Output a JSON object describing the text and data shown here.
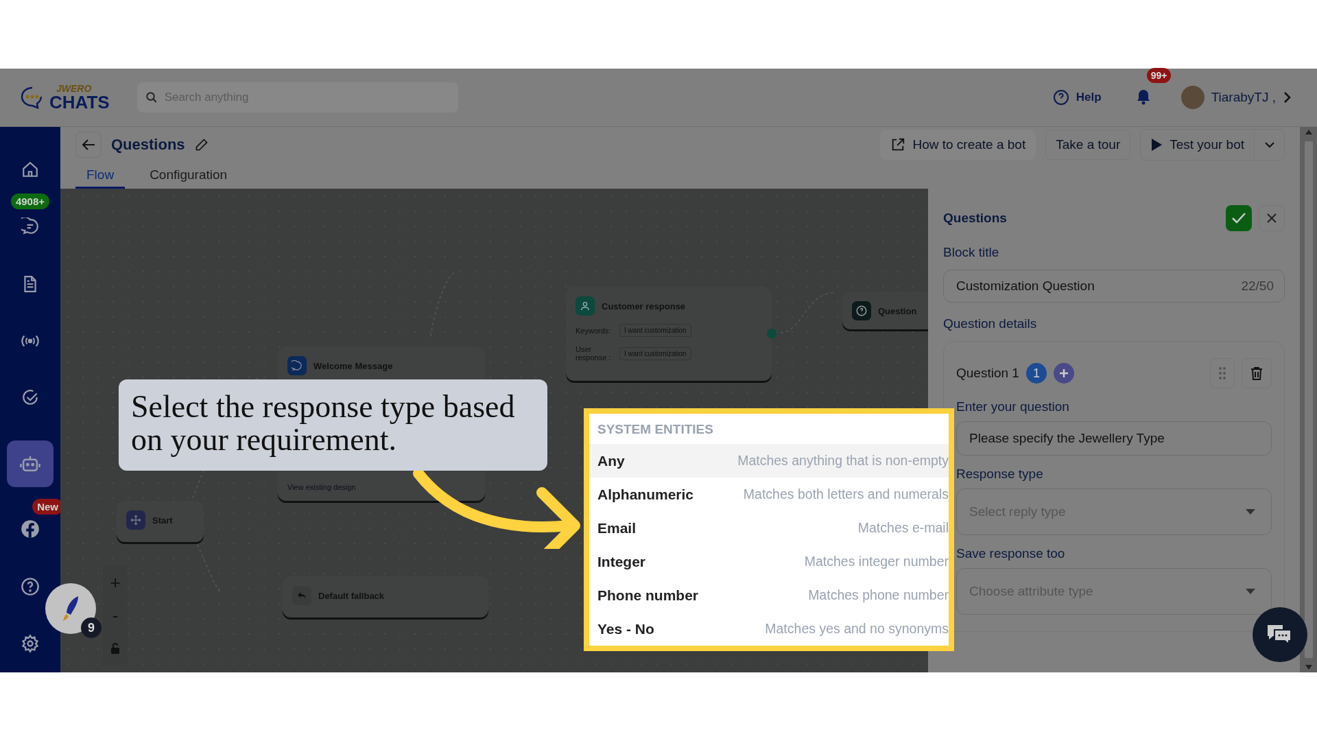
{
  "header": {
    "logo_top": "JWERO",
    "logo_bottom": "CHATS",
    "search": {
      "placeholder": "Search anything"
    },
    "help": "Help",
    "notifications": "99+",
    "user": "TiarabyTJ ,"
  },
  "sidebar": {
    "items": [
      {
        "kind": "home",
        "selected": false
      },
      {
        "kind": "chat",
        "selected": false,
        "badge": {
          "text": "4908+",
          "color": "#0d6b12"
        }
      },
      {
        "kind": "document",
        "selected": false
      },
      {
        "kind": "broadcast",
        "selected": false
      },
      {
        "kind": "check",
        "selected": false
      },
      {
        "kind": "bot",
        "selected": true
      },
      {
        "kind": "facebook",
        "selected": false,
        "badge": {
          "text": "New",
          "color": "#8e1313"
        }
      },
      {
        "kind": "help",
        "selected": false
      },
      {
        "kind": "settings",
        "selected": false
      }
    ]
  },
  "launcher": {
    "count": "9"
  },
  "page": {
    "title": "Questions",
    "actions": [
      {
        "label": "How to create a bot",
        "kind": "link"
      },
      {
        "label": "Take a tour",
        "kind": "plain"
      },
      {
        "label": "Test your bot",
        "kind": "play"
      }
    ],
    "tabs": [
      {
        "label": "Flow",
        "selected": true
      },
      {
        "label": "Configuration",
        "selected": false
      }
    ]
  },
  "canvas": {
    "nodes": [
      {
        "kind": "customer_response",
        "title": "Customer response",
        "fields": [
          {
            "label": "Keywords:",
            "value": "I want customization"
          },
          {
            "label": "User response :",
            "value": "I want customization"
          }
        ]
      },
      {
        "kind": "question",
        "title": "Question"
      },
      {
        "kind": "message",
        "title": "Welcome Message",
        "link": "View existing design"
      },
      {
        "kind": "start",
        "title": "Start"
      },
      {
        "kind": "fallback",
        "title": "Default fallback"
      }
    ],
    "zoom_controls": [
      "+",
      "-"
    ]
  },
  "tutorial": {
    "callout": "Select the response type based on your requirement."
  },
  "entities": {
    "heading": "SYSTEM ENTITIES",
    "items": [
      {
        "name": "Any",
        "description": "Matches anything that is non-empty",
        "selected": true
      },
      {
        "name": "Alphanumeric",
        "description": "Matches both letters and numerals",
        "selected": false
      },
      {
        "name": "Email",
        "description": "Matches e-mail",
        "selected": false
      },
      {
        "name": "Integer",
        "description": "Matches integer number",
        "selected": false
      },
      {
        "name": "Phone number",
        "description": "Matches phone number",
        "selected": false
      },
      {
        "name": "Yes - No",
        "description": "Matches yes and no synonyms",
        "selected": false
      }
    ]
  },
  "panel": {
    "title": "Questions",
    "block_title": {
      "label": "Block title",
      "value": "Customization Question",
      "counter": "22/50"
    },
    "section": "Question details",
    "question": {
      "label": "Question 1",
      "number": "1",
      "fields": [
        {
          "kind": "text",
          "label": "Enter your question",
          "value": "Please specify the Jewellery Type"
        },
        {
          "kind": "select",
          "label": "Response type",
          "placeholder": "Select reply type"
        },
        {
          "kind": "select",
          "label": "Save response too",
          "placeholder": "Choose attribute type"
        }
      ]
    }
  }
}
